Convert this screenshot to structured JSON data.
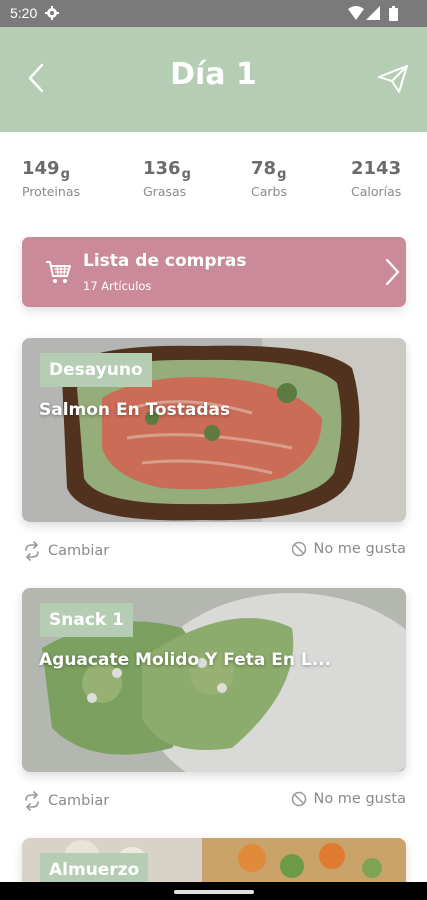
{
  "status_bar": {
    "time": "5:20"
  },
  "header": {
    "title": "Día 1"
  },
  "macros": [
    {
      "value": "149",
      "unit": "g",
      "label": "Proteinas"
    },
    {
      "value": "136",
      "unit": "g",
      "label": "Grasas"
    },
    {
      "value": "78",
      "unit": "g",
      "label": "Carbs"
    },
    {
      "value": "2143",
      "unit": "",
      "label": "Calorías"
    }
  ],
  "shopping_list": {
    "title": "Lista de compras",
    "subtitle": "17 Artículos"
  },
  "meals": [
    {
      "category": "Desayuno",
      "name": "Salmon En Tostadas"
    },
    {
      "category": "Snack 1",
      "name": "Aguacate Molido Y Feta En L..."
    },
    {
      "category": "Almuerzo",
      "name": ""
    }
  ],
  "actions": {
    "swap_label": "Cambiar",
    "dislike_label": "No me gusta"
  },
  "colors": {
    "header": "#b4cdb3",
    "shopping": "#cb8a99",
    "badge": "#b4cdb3"
  }
}
